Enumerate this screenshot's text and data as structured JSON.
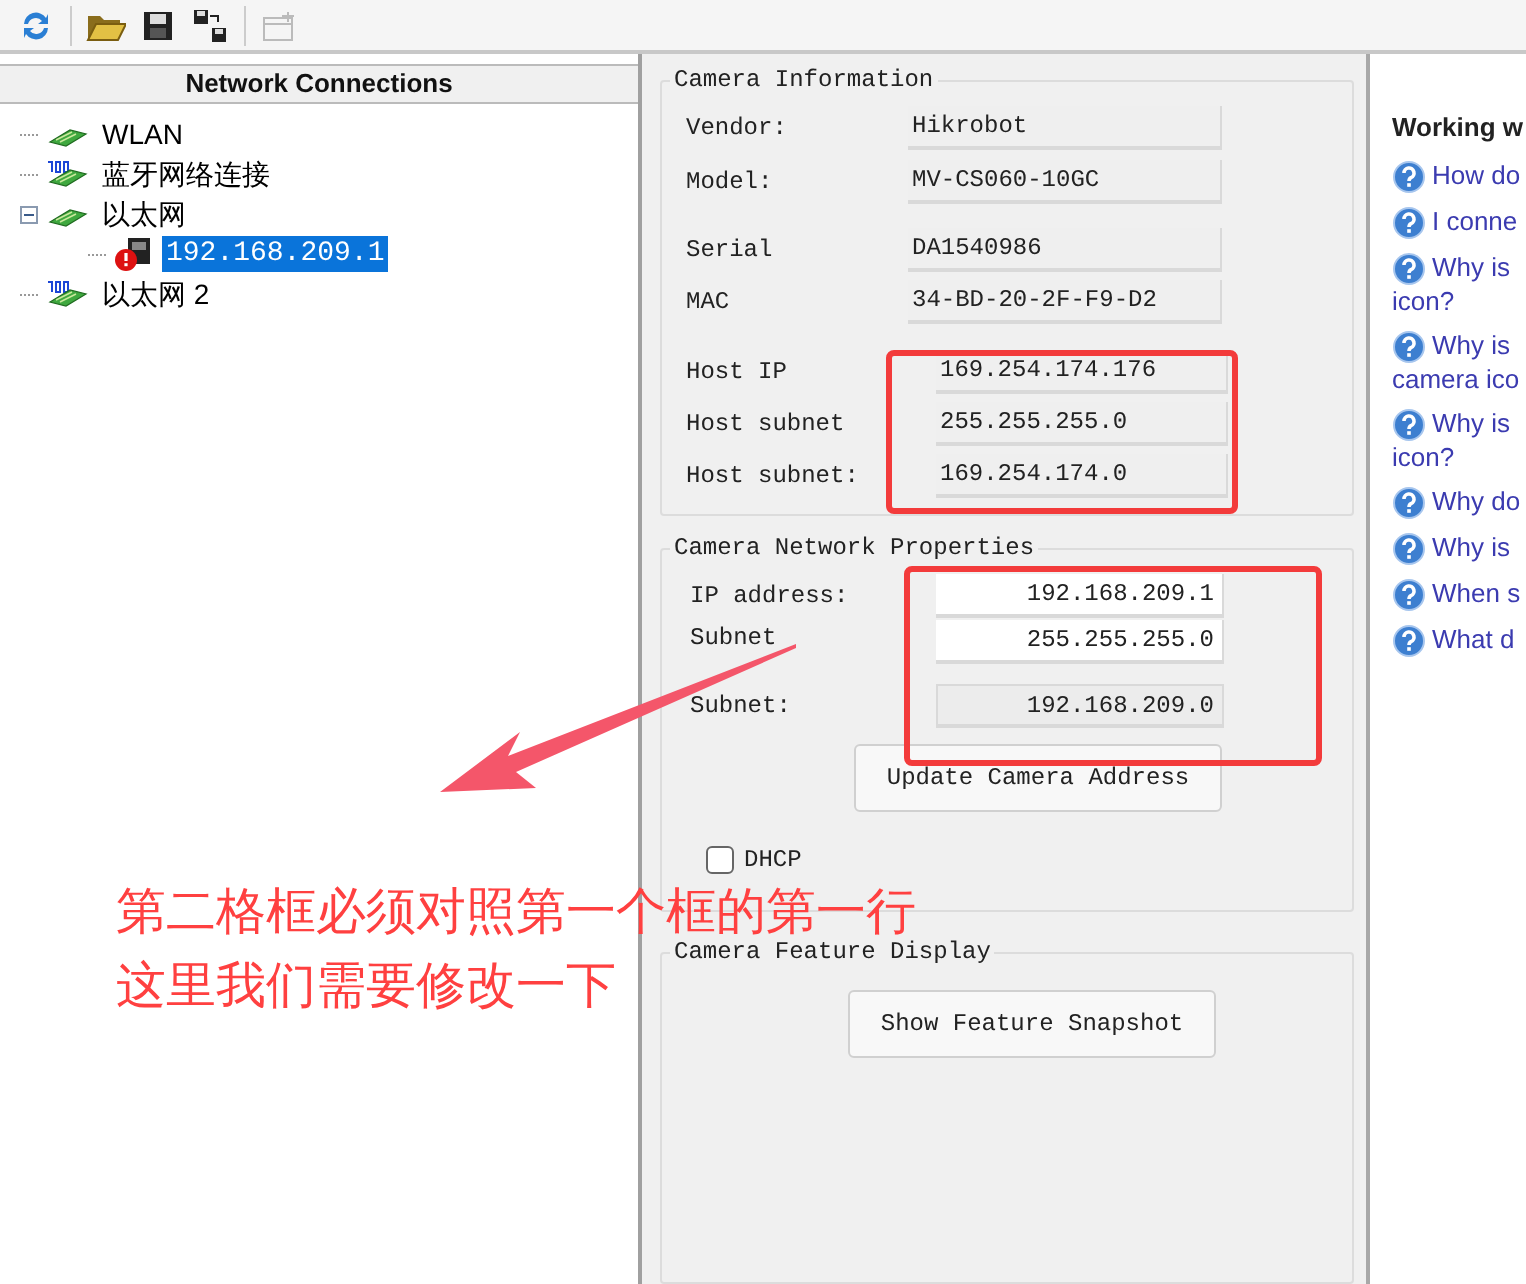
{
  "toolbar": [
    {
      "kind": "refresh",
      "disabled": false
    },
    {
      "kind": "open",
      "disabled": false
    },
    {
      "kind": "save",
      "disabled": false
    },
    {
      "kind": "save-all",
      "disabled": false
    },
    {
      "kind": "new",
      "disabled": true
    }
  ],
  "connections": {
    "title": "Network Connections",
    "tree": [
      {
        "label": "WLAN",
        "kind": "adapter",
        "selected": false
      },
      {
        "label": "蓝牙网络连接",
        "kind": "bluetooth",
        "selected": false
      },
      {
        "label": "以太网",
        "kind": "adapter",
        "selected": false,
        "expanded": true,
        "children": [
          {
            "label": "192.168.209.1",
            "kind": "camera",
            "selected": true
          }
        ]
      },
      {
        "label": "以太网 2",
        "kind": "bluetooth",
        "selected": false
      }
    ]
  },
  "camera_information": {
    "title": "Camera Information",
    "fields": [
      {
        "label": "Vendor:",
        "value": "Hikrobot",
        "kind": "info"
      },
      {
        "label": "Model:",
        "value": "MV-CS060-10GC",
        "kind": "info"
      },
      {
        "label": "Serial",
        "value": "DA1540986",
        "kind": "info"
      },
      {
        "label": "MAC",
        "value": "34-BD-20-2F-F9-D2",
        "kind": "info"
      },
      {
        "label": "Host IP",
        "value": "169.254.174.176",
        "kind": "host"
      },
      {
        "label": "Host subnet",
        "value": "255.255.255.0",
        "kind": "host"
      },
      {
        "label": "Host subnet:",
        "value": "169.254.174.0",
        "kind": "host"
      }
    ]
  },
  "camera_network_properties": {
    "title": "Camera Network Properties",
    "fields": [
      {
        "label": "IP address:",
        "value": "192.168.209.1",
        "editable": true
      },
      {
        "label": "Subnet",
        "value": "255.255.255.0",
        "editable": true
      },
      {
        "label": "Subnet:",
        "value": "192.168.209.0",
        "editable": false
      }
    ],
    "button": "Update Camera Address",
    "dhcp": {
      "label": "DHCP",
      "checked": false
    }
  },
  "camera_feature_display": {
    "title": "Camera Feature Display",
    "button": "Show Feature Snapshot"
  },
  "help": {
    "title": "Working w",
    "items": [
      {
        "lines": [
          "How do"
        ]
      },
      {
        "lines": [
          "I conne"
        ]
      },
      {
        "lines": [
          "Why is",
          "icon?"
        ]
      },
      {
        "lines": [
          "Why is",
          "camera ico"
        ]
      },
      {
        "lines": [
          "Why is",
          "icon?"
        ]
      },
      {
        "lines": [
          "Why do"
        ]
      },
      {
        "lines": [
          "Why is"
        ]
      },
      {
        "lines": [
          "When s"
        ]
      },
      {
        "lines": [
          "What d"
        ]
      }
    ]
  },
  "annotation": {
    "lines": [
      "第二格框必须对照第一个框的第一行",
      "这里我们需要修改一下"
    ]
  }
}
